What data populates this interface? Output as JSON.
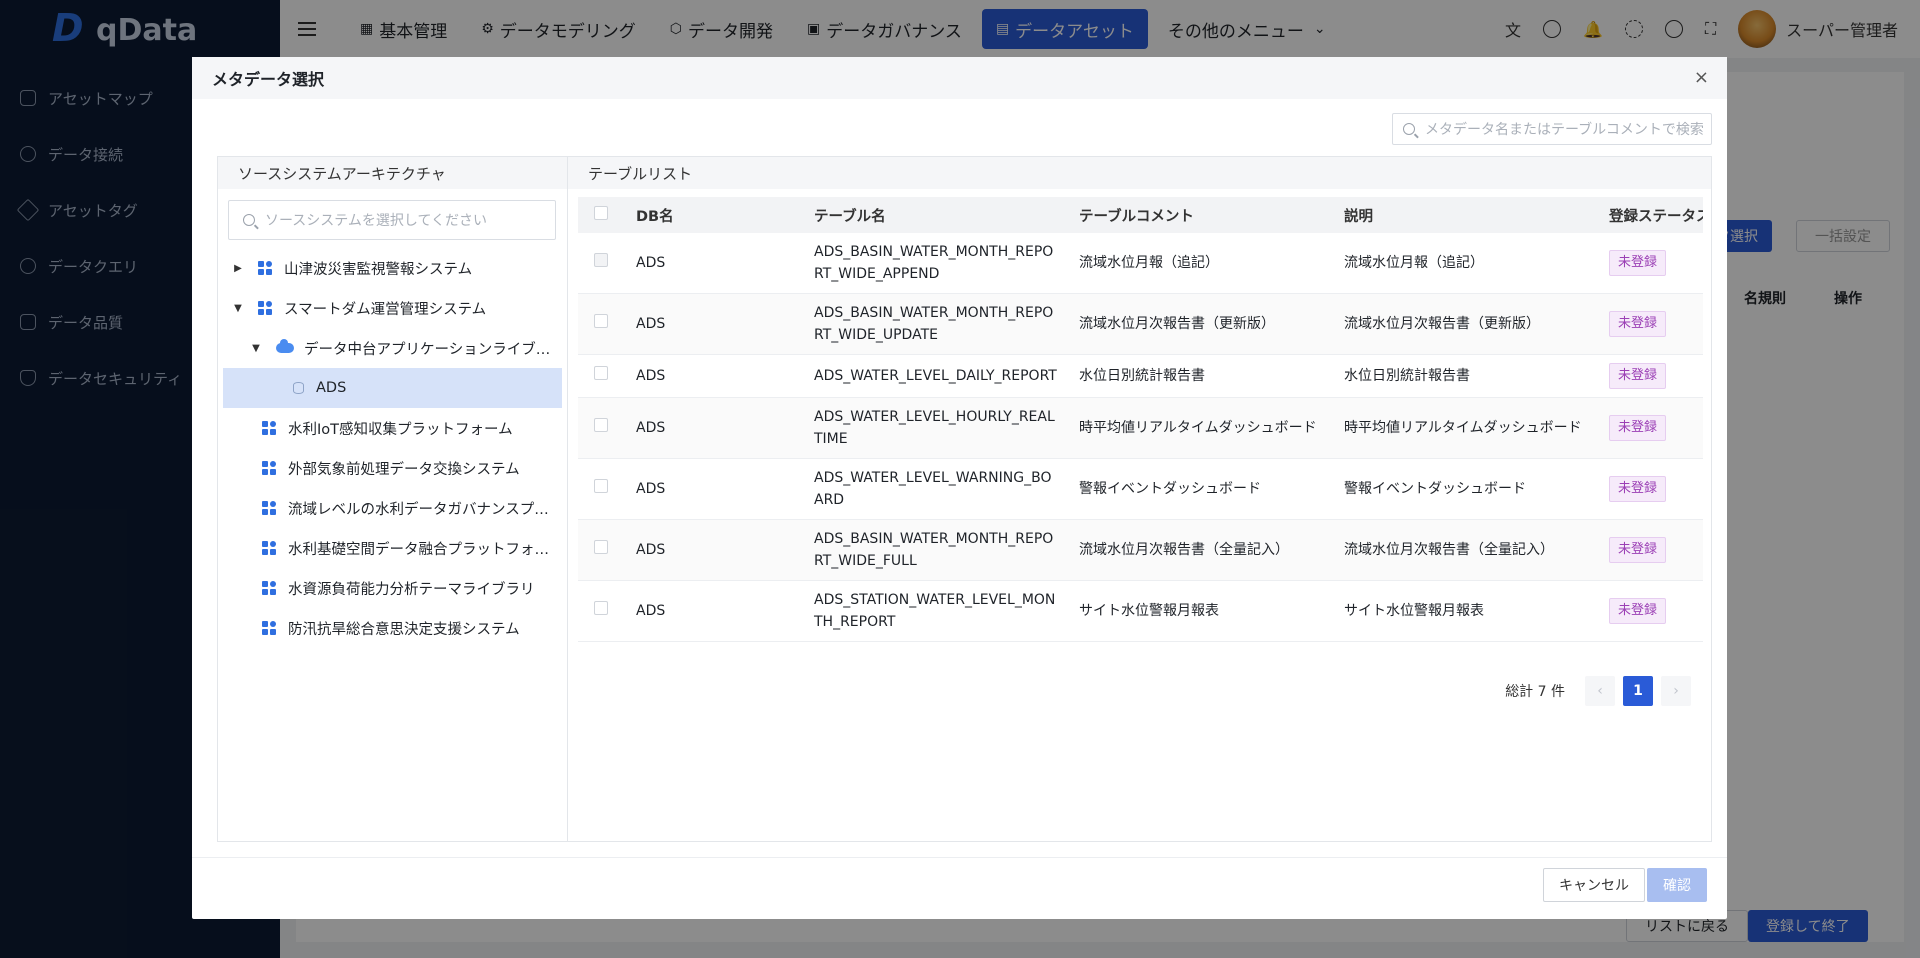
{
  "app": {
    "logo_text": "qData",
    "sidebar": [
      {
        "label": "アセットマップ"
      },
      {
        "label": "データ接続"
      },
      {
        "label": "アセットタグ"
      },
      {
        "label": "データクエリ"
      },
      {
        "label": "データ品質"
      },
      {
        "label": "データセキュリティ"
      }
    ],
    "topnav": [
      {
        "label": "基本管理",
        "glyph": "▦"
      },
      {
        "label": "データモデリング",
        "glyph": "⚙"
      },
      {
        "label": "データ開発",
        "glyph": "⬡"
      },
      {
        "label": "データガバナンス",
        "glyph": "▣"
      },
      {
        "label": "データアセット",
        "glyph": "▤"
      },
      {
        "label": "その他のメニュー",
        "glyph": ""
      }
    ],
    "more_caret": "⌄",
    "user_name": "スーパー管理者",
    "bg_buttons": {
      "select": "タ選択",
      "bulk": "一括設定",
      "col_rule": "名規則",
      "col_op": "操作",
      "back": "リストに戻る",
      "register": "登録して終了"
    }
  },
  "modal": {
    "title": "メタデータ選択",
    "close_glyph": "×",
    "search_placeholder": "メタデータ名またはテーブルコメントで検索",
    "left_panel_title": "ソースシステムアーキテクチャ",
    "tree_search_placeholder": "ソースシステムを選択してください",
    "tree": [
      {
        "label": "山津波災害監視警報システム",
        "caret": "▶"
      },
      {
        "label": "スマートダム運営管理システム",
        "caret": "▼"
      },
      {
        "label": "データ中台アプリケーションライブ…",
        "caret": "▼"
      },
      {
        "label": "ADS",
        "caret": ""
      },
      {
        "label": "水利IoT感知収集プラットフォーム",
        "caret": ""
      },
      {
        "label": "外部気象前処理データ交換システム",
        "caret": ""
      },
      {
        "label": "流域レベルの水利データガバナンスプ…",
        "caret": ""
      },
      {
        "label": "水利基礎空間データ融合プラットフォ…",
        "caret": ""
      },
      {
        "label": "水資源負荷能力分析テーマライブラリ",
        "caret": ""
      },
      {
        "label": "防汛抗旱総合意思決定支援システム",
        "caret": ""
      }
    ],
    "right_panel_title": "テーブルリスト",
    "columns": [
      "DB名",
      "テーブル名",
      "テーブルコメント",
      "説明",
      "登録ステータス"
    ],
    "rows": [
      {
        "db": "ADS",
        "table": "ADS_BASIN_WATER_MONTH_REPORT_WIDE_APPEND",
        "comment": "流域水位月報（追記）",
        "desc": "流域水位月報（追記）",
        "status": "未登録"
      },
      {
        "db": "ADS",
        "table": "ADS_BASIN_WATER_MONTH_REPORT_WIDE_UPDATE",
        "comment": "流域水位月次報告書（更新版）",
        "desc": "流域水位月次報告書（更新版）",
        "status": "未登録"
      },
      {
        "db": "ADS",
        "table": "ADS_WATER_LEVEL_DAILY_REPORT",
        "comment": "水位日別統計報告書",
        "desc": "水位日別統計報告書",
        "status": "未登録"
      },
      {
        "db": "ADS",
        "table": "ADS_WATER_LEVEL_HOURLY_REALTIME",
        "comment": "時平均値リアルタイムダッシュボード",
        "desc": "時平均値リアルタイムダッシュボード",
        "status": "未登録"
      },
      {
        "db": "ADS",
        "table": "ADS_WATER_LEVEL_WARNING_BOARD",
        "comment": "警報イベントダッシュボード",
        "desc": "警報イベントダッシュボード",
        "status": "未登録"
      },
      {
        "db": "ADS",
        "table": "ADS_BASIN_WATER_MONTH_REPORT_WIDE_FULL",
        "comment": "流域水位月次報告書（全量記入）",
        "desc": "流域水位月次報告書（全量記入）",
        "status": "未登録"
      },
      {
        "db": "ADS",
        "table": "ADS_STATION_WATER_LEVEL_MONTH_REPORT",
        "comment": "サイト水位警報月報表",
        "desc": "サイト水位警報月報表",
        "status": "未登録"
      }
    ],
    "pagination": {
      "total": "総計 7 件",
      "prev": "‹",
      "page": "1",
      "next": "›"
    },
    "cancel_label": "キャンセル",
    "confirm_label": "確認"
  }
}
